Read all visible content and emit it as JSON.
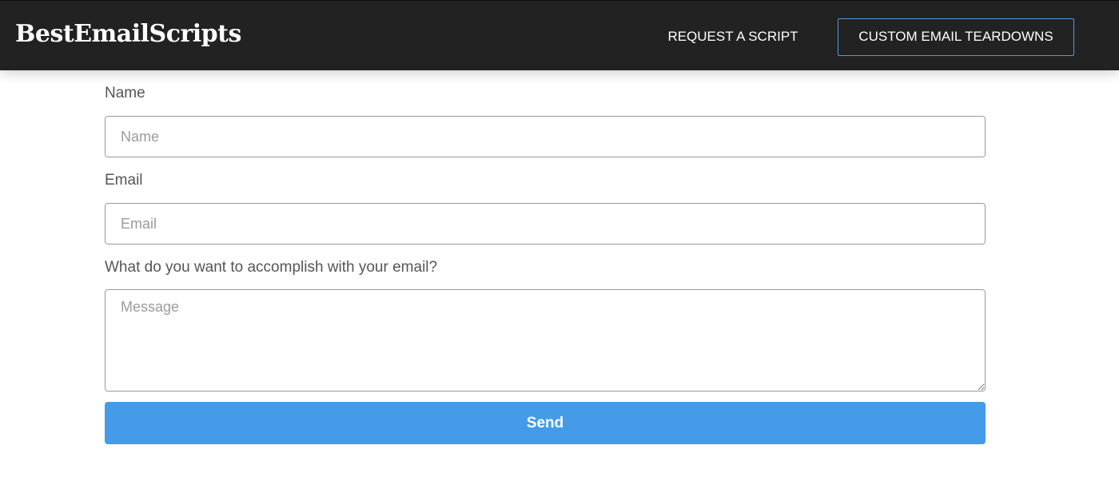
{
  "header": {
    "brand": "BestEmailScripts",
    "nav_request": "REQUEST A SCRIPT",
    "nav_teardowns": "CUSTOM EMAIL TEARDOWNS"
  },
  "form": {
    "name_label": "Name",
    "name_placeholder": "Name",
    "name_value": "",
    "email_label": "Email",
    "email_placeholder": "Email",
    "email_value": "",
    "message_label": "What do you want to accomplish with your email?",
    "message_placeholder": "Message",
    "message_value": "",
    "send_label": "Send"
  },
  "colors": {
    "header_bg": "#222222",
    "cta_border": "#4b9ae6",
    "button_bg": "#449ce8",
    "label_text": "#555555",
    "placeholder_text": "#9b9b9b"
  }
}
